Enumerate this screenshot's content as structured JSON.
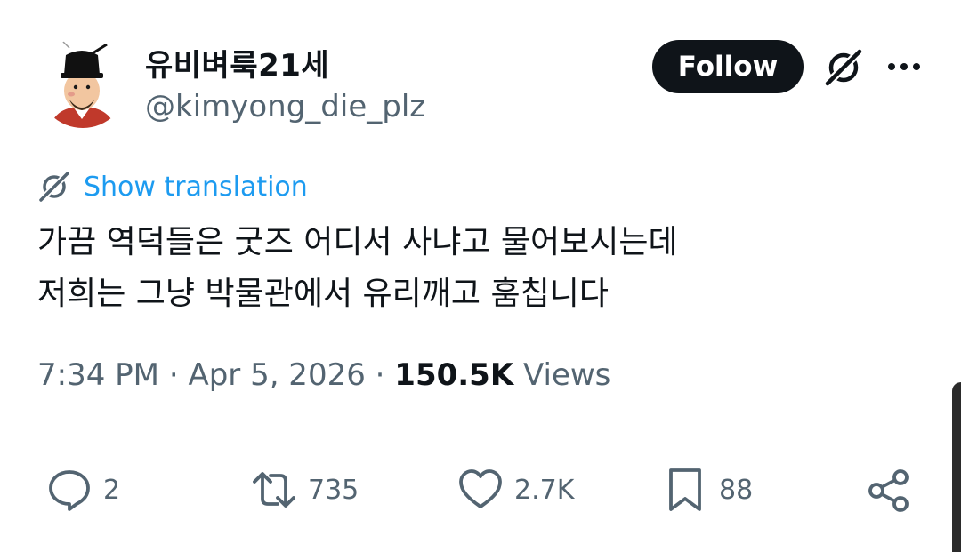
{
  "author": {
    "display_name": "유비벼룩21세",
    "handle": "@kimyong_die_plz"
  },
  "header": {
    "follow_label": "Follow"
  },
  "translation": {
    "link_label": "Show translation"
  },
  "tweet": {
    "lines": [
      "가끔 역덕들은 굿즈 어디서 사냐고 물어보시는데",
      "저희는 그냥 박물관에서 유리깨고 훔칩니다"
    ]
  },
  "meta": {
    "time": "7:34 PM",
    "date": "Apr 5, 2026",
    "separator": "·",
    "views_count": "150.5K",
    "views_label": "Views"
  },
  "actions": {
    "replies": "2",
    "reposts": "735",
    "likes": "2.7K",
    "bookmarks": "88"
  },
  "icons": {
    "avatar": "avatar-cartoon-scholar",
    "grok": "grok-icon",
    "more": "more-icon",
    "translate": "grok-translate-icon",
    "reply": "reply-icon",
    "repost": "repost-icon",
    "like": "heart-icon",
    "bookmark": "bookmark-icon",
    "share": "share-icon"
  },
  "colors": {
    "text": "#0f1419",
    "muted": "#536471",
    "link": "#1d9bf0",
    "follow_bg": "#0f1419"
  }
}
